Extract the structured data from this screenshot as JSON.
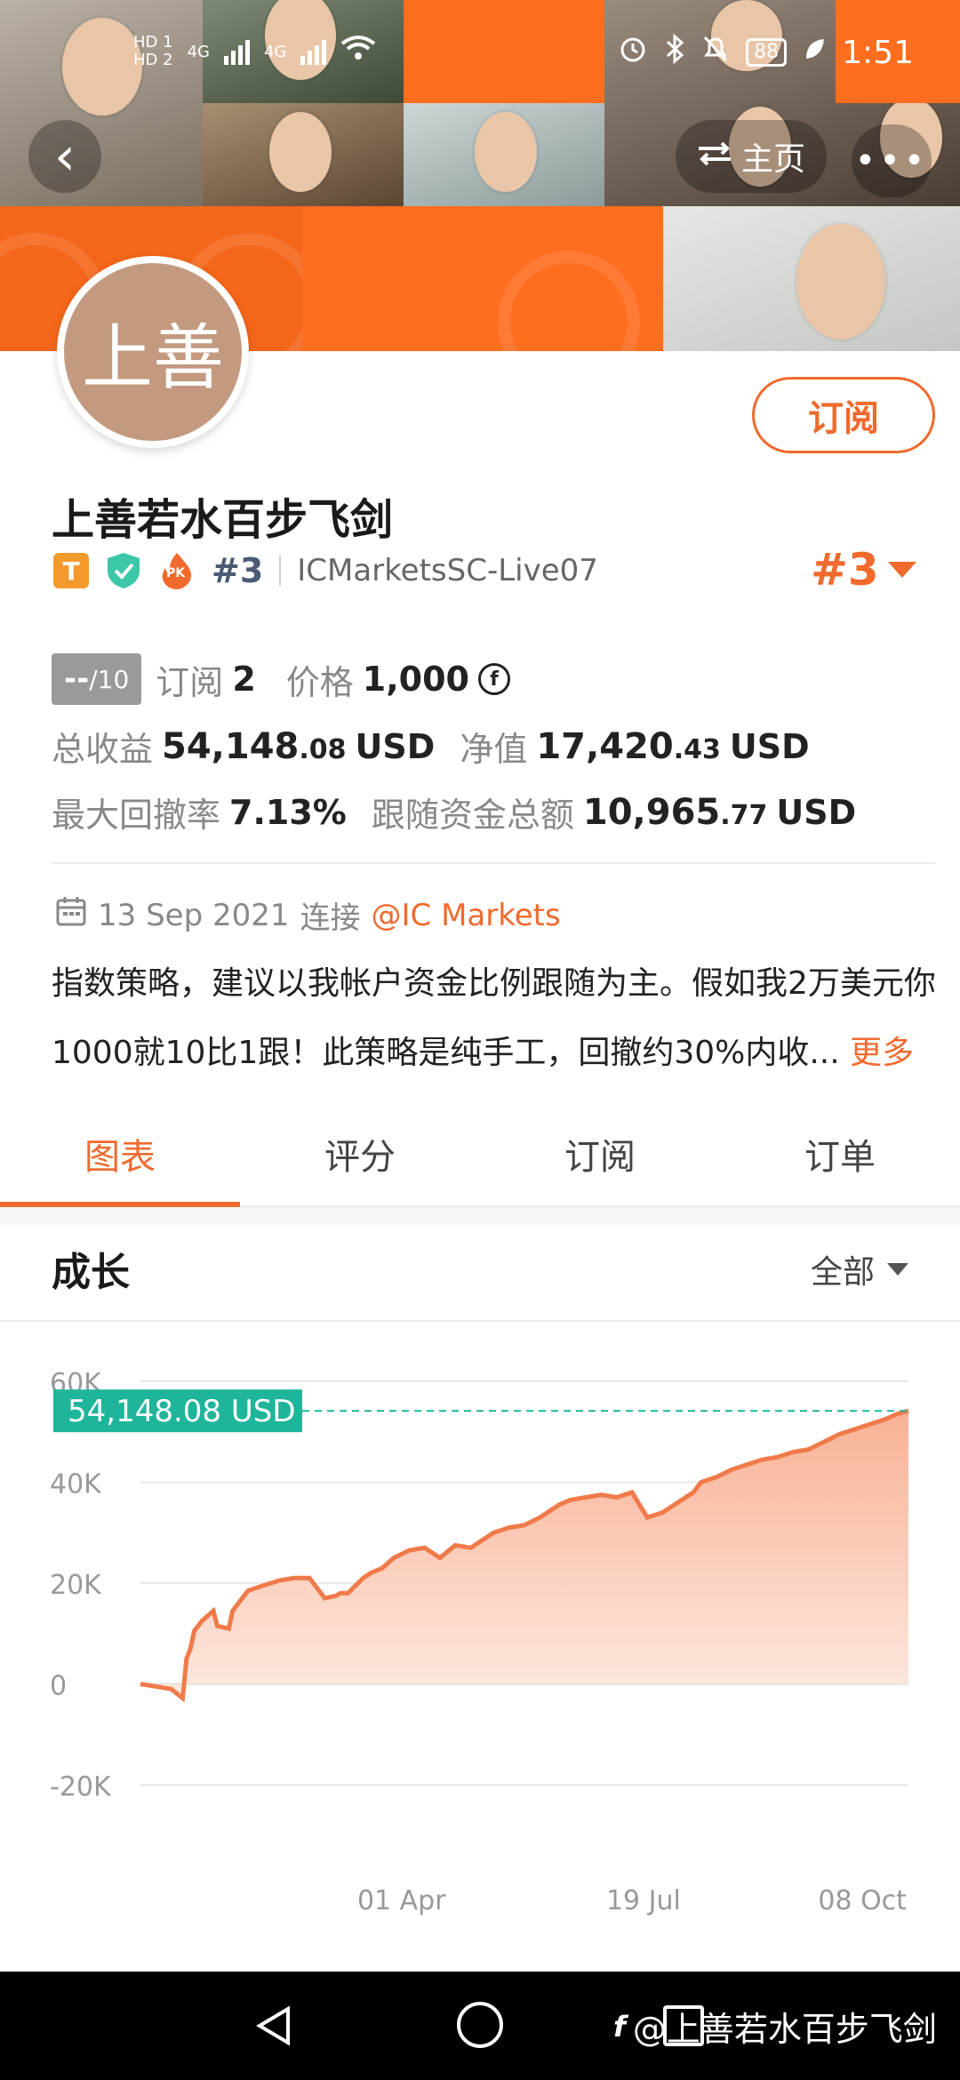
{
  "status_bar": {
    "left_labels": [
      "HD 1",
      "HD 2"
    ],
    "network": [
      "4G",
      "4G"
    ],
    "battery": "88",
    "time": "1:51"
  },
  "header": {
    "home_label": "主页",
    "more_label": "•••"
  },
  "profile": {
    "avatar_text": "上善",
    "subscribe_label": "订阅",
    "name": "上善若水百步飞剑",
    "badge_t": "T",
    "badge_pk": "PK",
    "rank_small": "#3",
    "server": "ICMarketsSC-Live07",
    "rank_big": "#3"
  },
  "stats": {
    "score_dash": "--",
    "score_total": "/10",
    "subscribers_label": "订阅",
    "subscribers_value": "2",
    "price_label": "价格",
    "price_value": "1,000",
    "coin_symbol": "f",
    "total_profit_label": "总收益",
    "total_profit_value": "54,148",
    "total_profit_cents": ".08",
    "total_profit_unit": "USD",
    "equity_label": "净值",
    "equity_value": "17,420",
    "equity_cents": ".43",
    "equity_unit": "USD",
    "max_drawdown_label": "最大回撤率",
    "max_drawdown_value": "7.13%",
    "follow_funds_label": "跟随资金总额",
    "follow_funds_value": "10,965",
    "follow_funds_cents": ".77",
    "follow_funds_unit": "USD"
  },
  "connection": {
    "date": "13 Sep 2021",
    "connect_label": "连接",
    "broker": "@IC Markets"
  },
  "description": {
    "line1": "指数策略，建议以我帐户资金比例跟随为主。假如我2万美元你",
    "line2": "1000就10比1跟！此策略是纯手工，回撤约30%内收...",
    "more_label": "更多"
  },
  "tabs": [
    "图表",
    "评分",
    "订阅",
    "订单"
  ],
  "growth": {
    "title": "成长",
    "filter_label": "全部"
  },
  "chart_data": {
    "type": "area",
    "title": "成长",
    "y_ticks": [
      "60K",
      "40K",
      "20K",
      "0",
      "-20K"
    ],
    "y_tick_values": [
      60000,
      40000,
      20000,
      0,
      -20000
    ],
    "x_ticks": [
      "01 Apr",
      "19 Jul",
      "08 Oct"
    ],
    "x_tick_positions": [
      0.34,
      0.655,
      0.94
    ],
    "ylim": [
      -20000,
      60000
    ],
    "current_value": 54148.08,
    "current_label": "54,148.08 USD",
    "colors": {
      "line": "#f07a4a",
      "fill_top": "#f8b195",
      "fill_bottom": "#fde9df",
      "marker": "#1fb59a",
      "grid": "#e8e8e8"
    },
    "series": [
      {
        "x": [
          0,
          0.02,
          0.04,
          0.055,
          0.06,
          0.065,
          0.07,
          0.075,
          0.08,
          0.095,
          0.1,
          0.115,
          0.12,
          0.135,
          0.14,
          0.16,
          0.18,
          0.2,
          0.22,
          0.24,
          0.255,
          0.26,
          0.27,
          0.29,
          0.3,
          0.315,
          0.33,
          0.35,
          0.37,
          0.39,
          0.41,
          0.43,
          0.44,
          0.46,
          0.48,
          0.5,
          0.52,
          0.545,
          0.56,
          0.58,
          0.6,
          0.62,
          0.64,
          0.66,
          0.68,
          0.7,
          0.71,
          0.72,
          0.73,
          0.75,
          0.77,
          0.79,
          0.81,
          0.83,
          0.85,
          0.87,
          0.89,
          0.91,
          0.93,
          0.95,
          0.97,
          0.985,
          1.0
        ],
        "y": [
          0,
          -500,
          -1000,
          -2800,
          5000,
          7000,
          10500,
          11500,
          12500,
          14500,
          11500,
          11000,
          14500,
          17500,
          18500,
          19500,
          20500,
          21000,
          21000,
          17000,
          17500,
          18000,
          18000,
          21000,
          22000,
          23000,
          25000,
          26500,
          27000,
          25000,
          27500,
          27000,
          28000,
          30000,
          31000,
          31500,
          33000,
          35500,
          36500,
          37000,
          37500,
          37000,
          38000,
          33000,
          34000,
          36000,
          37000,
          38000,
          40000,
          41000,
          42500,
          43500,
          44500,
          45000,
          46000,
          46500,
          48000,
          49500,
          50500,
          51500,
          52500,
          53500,
          54148
        ]
      }
    ]
  },
  "watermark": {
    "logo": "f",
    "text": "@上善若水百步飞剑"
  }
}
